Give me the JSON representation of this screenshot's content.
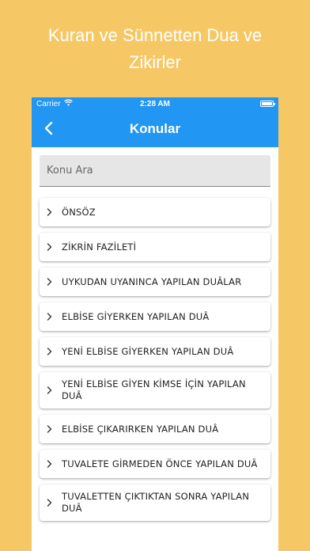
{
  "promo": {
    "title": "Kuran ve Sünnetten Dua ve Zikirler"
  },
  "status_bar": {
    "carrier": "Carrier",
    "time": "2:28 AM"
  },
  "nav": {
    "title": "Konular"
  },
  "search": {
    "placeholder": "Konu Ara",
    "value": ""
  },
  "topics": [
    {
      "label": "ÖNSÖZ"
    },
    {
      "label": "ZİKRİN FAZİLETİ"
    },
    {
      "label": "UYKUDAN UYANINCA YAPILAN DUÂLAR"
    },
    {
      "label": "ELBİSE GİYERKEN YAPILAN DUÂ"
    },
    {
      "label": "YENİ ELBİSE GİYERKEN YAPILAN DUÂ"
    },
    {
      "label": "YENİ ELBİSE GİYEN KİMSE İÇİN YAPILAN DUÂ"
    },
    {
      "label": "ELBİSE ÇIKARIRKEN YAPILAN DUÂ"
    },
    {
      "label": "TUVALETE GİRMEDEN ÖNCE YAPILAN DUÂ"
    },
    {
      "label": "TUVALETTEN ÇIKTIKTAN SONRA YAPILAN DUÂ"
    }
  ],
  "colors": {
    "background": "#f5c865",
    "accent": "#2196f3"
  },
  "icons": {
    "back": "chevron-left-icon",
    "item": "chevron-right-icon",
    "wifi": "wifi-icon",
    "battery": "battery-icon"
  }
}
